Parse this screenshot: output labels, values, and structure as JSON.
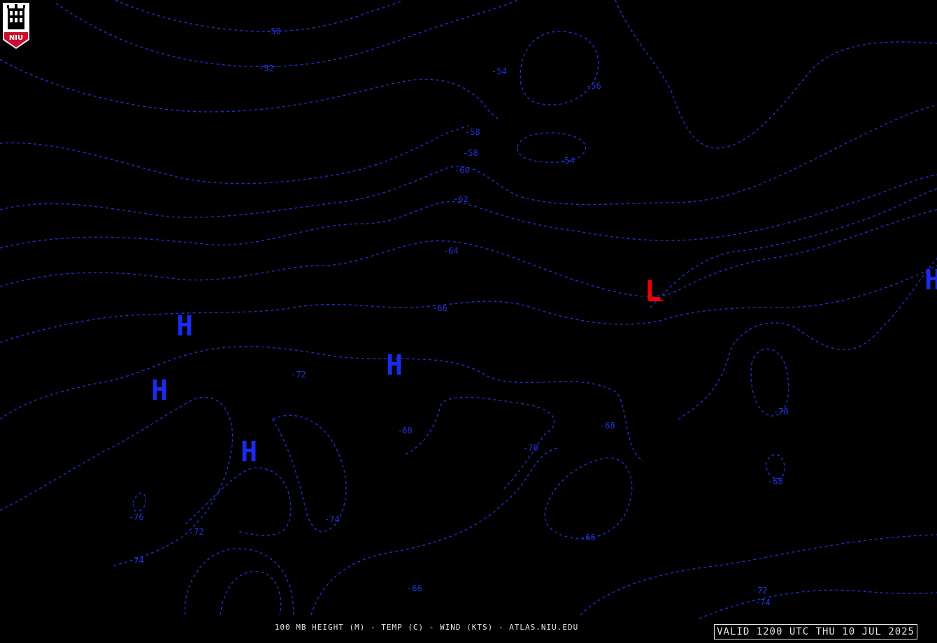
{
  "logo": {
    "text": "NIU",
    "icon": "niu-tower-logo"
  },
  "footer": {
    "caption": "100 MB HEIGHT (M) - TEMP (C) - WIND (KTS) - ATLAS.NIU.EDU"
  },
  "valid_time": "VALID 1200 UTC THU 10 JUL 2025",
  "colors": {
    "contour": "#2233dd",
    "high": "#1a2bf0",
    "low": "#ee0000",
    "background": "#000000",
    "text": "#e6e6e6"
  },
  "contour_labels": [
    "-50",
    "-52",
    "-54",
    "-56",
    "-58",
    "-58",
    "-60",
    "-62",
    "-64",
    "-66",
    "-54",
    "-72",
    "-68",
    "-70",
    "-68",
    "-70",
    "-68",
    "-66",
    "-66",
    "-76",
    "-72",
    "-74",
    "-74",
    "-72",
    "-74"
  ],
  "pressure_centers": [
    "H",
    "H",
    "H",
    "H",
    "H",
    "L"
  ]
}
